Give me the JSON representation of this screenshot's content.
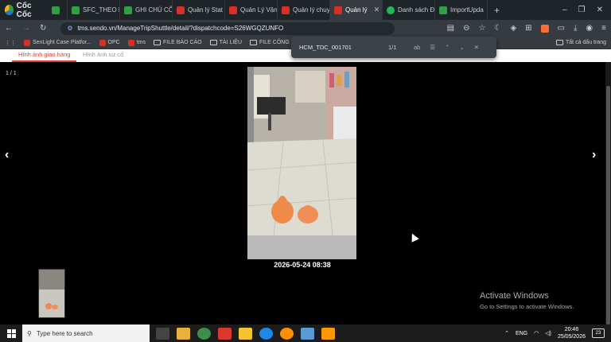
{
  "browser": {
    "brand": "Cốc Cốc",
    "tabs": [
      {
        "label": "",
        "favicon": "green"
      },
      {
        "label": "SFC_THEO D",
        "favicon": "green"
      },
      {
        "label": "GHI CHÚ CÔ",
        "favicon": "green"
      },
      {
        "label": "Quản lý Stat",
        "favicon": "red"
      },
      {
        "label": "Quản Lý Vận",
        "favicon": "red"
      },
      {
        "label": "Quản lý chuy",
        "favicon": "red"
      },
      {
        "label": "Quản lý",
        "favicon": "red",
        "active": true
      },
      {
        "label": "Danh sách Đ",
        "favicon": "spot"
      },
      {
        "label": "ImportUpda",
        "favicon": "green"
      }
    ],
    "url": "tms.sendo.vn/ManageTripShuttle/detail/?dispatchcode=S26WGQZUNFO",
    "bookmarks": [
      "SenLight Case Platfor...",
      "OPC",
      "tms",
      "FILE BÁO CÁO",
      "TÀI LIỆU",
      "FILE CÔNG VIỆC"
    ],
    "all_bookmarks": "Tất cả dấu trang"
  },
  "find": {
    "query": "HCM_TDC_001701",
    "count": "1/1"
  },
  "page": {
    "tabs": [
      "Hình ảnh giao hàng",
      "Hình ảnh sự cố"
    ],
    "counter": "1 / 1",
    "photo_timestamp": "2026-05-24 08:38",
    "prev_glyph": "‹",
    "next_glyph": "›"
  },
  "watermark": {
    "title": "Activate Windows",
    "subtitle": "Go to Settings to activate Windows."
  },
  "taskbar": {
    "search_placeholder": "Type here to search",
    "time": "20:46",
    "date": "25/05/2026",
    "notifications": "23"
  }
}
